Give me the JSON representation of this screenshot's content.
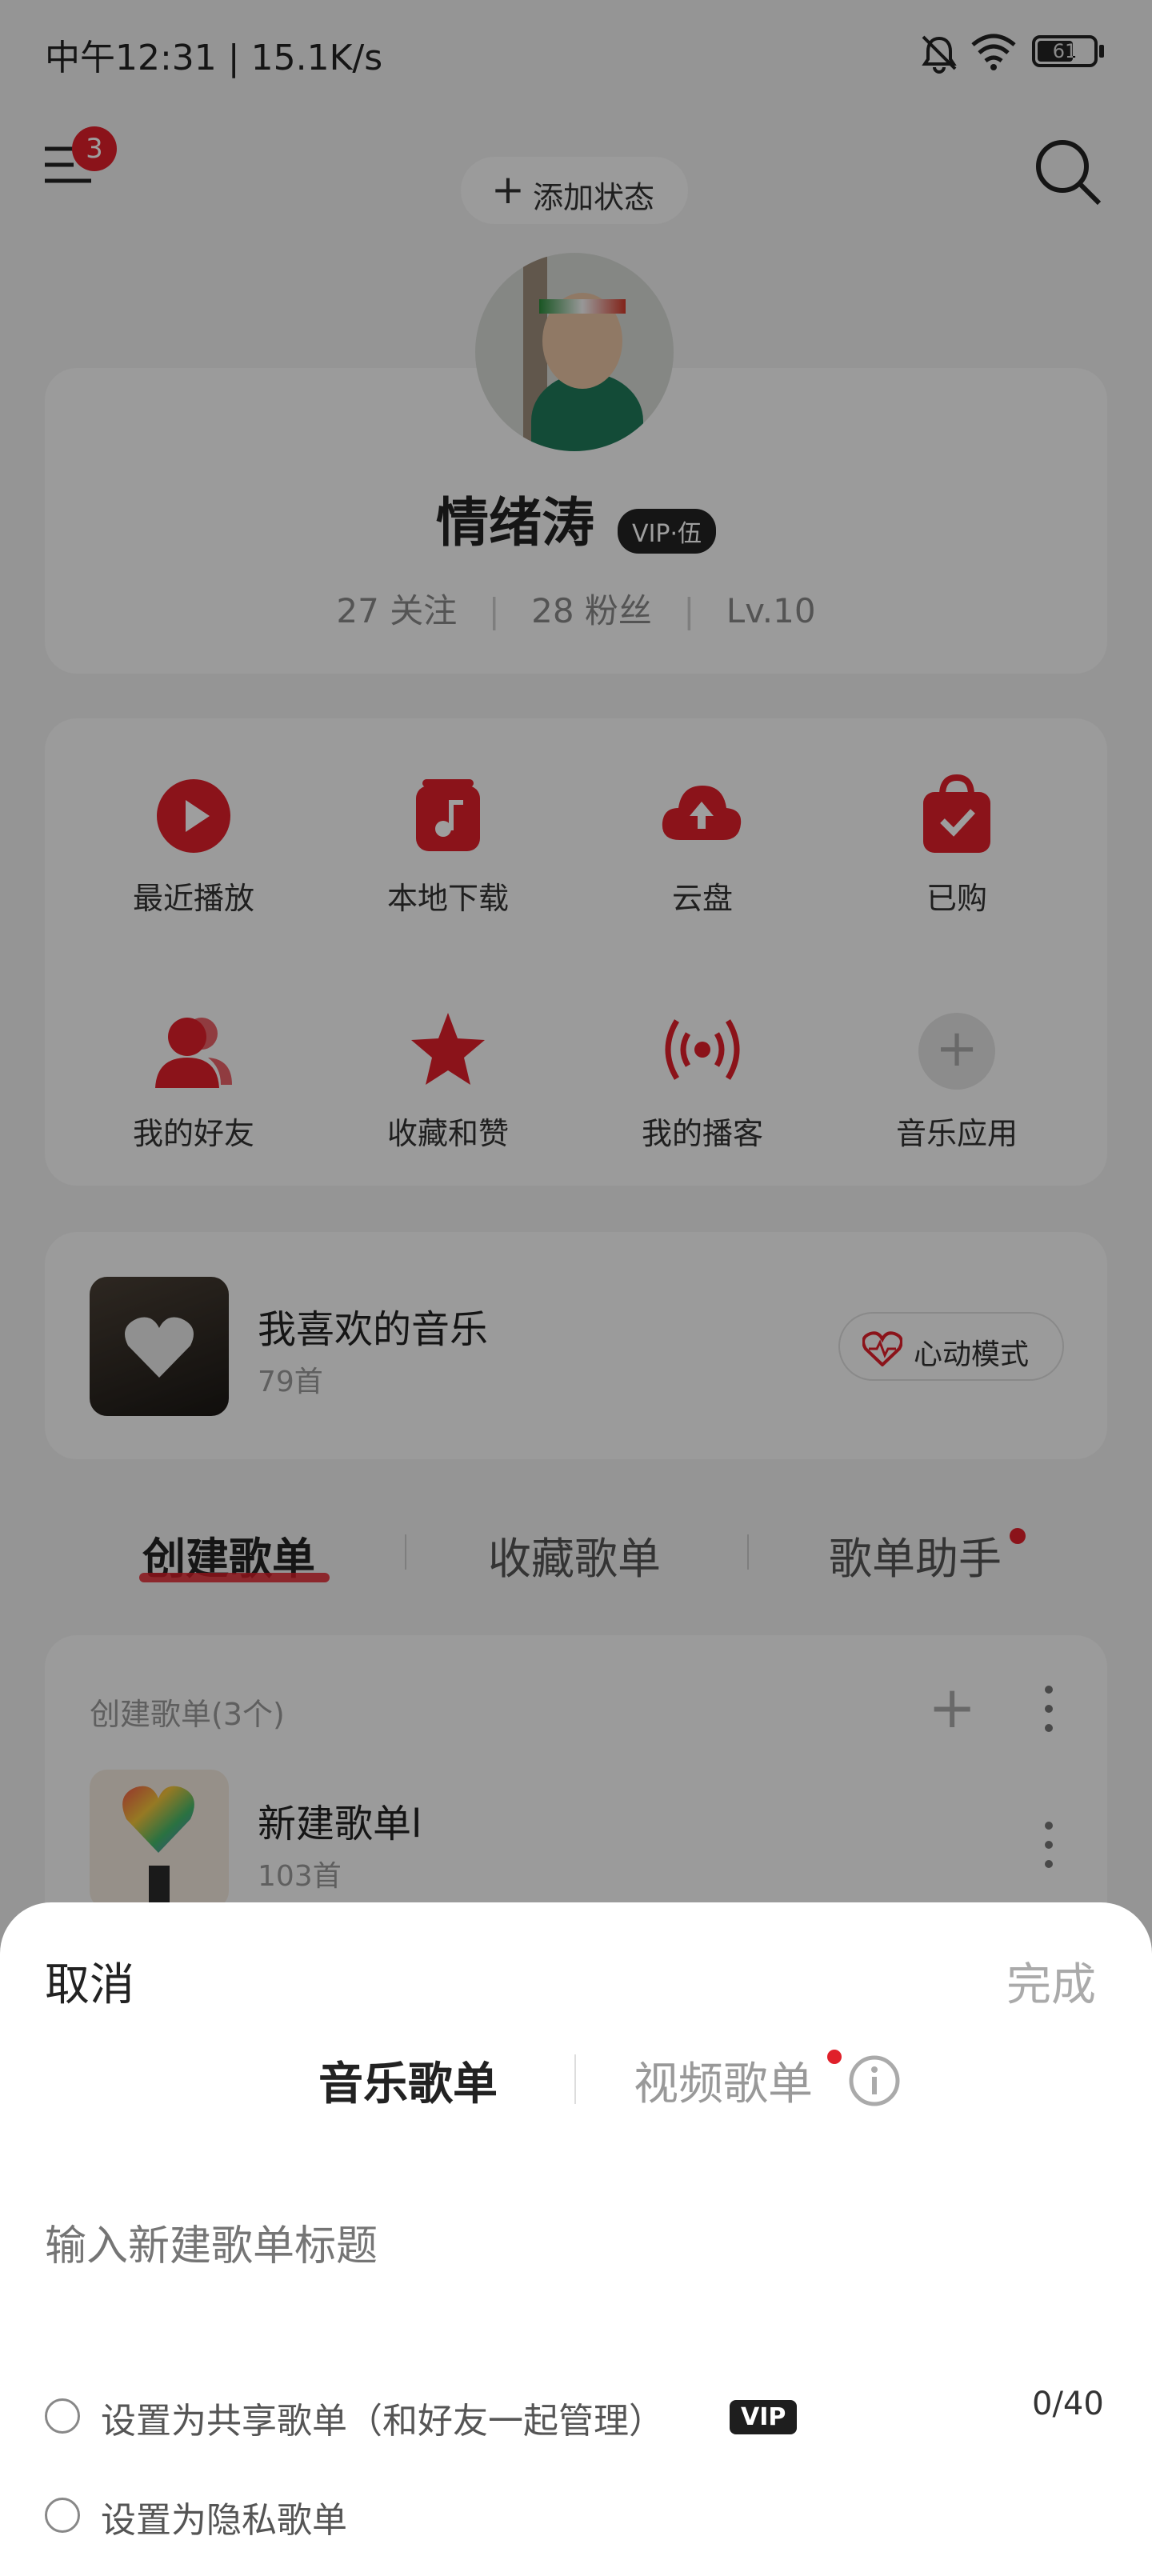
{
  "status_bar": {
    "time": "中午12:31",
    "network": "15.1K/s",
    "battery": "61"
  },
  "header": {
    "menu_badge": "3",
    "add_status": "添加状态"
  },
  "profile": {
    "name": "情绪涛",
    "vip_badge": "VIP·伍",
    "following": "27 关注",
    "fans": "28 粉丝",
    "level": "Lv.10"
  },
  "shortcuts": [
    {
      "label": "最近播放",
      "icon": "play-icon"
    },
    {
      "label": "本地下载",
      "icon": "music-download-icon"
    },
    {
      "label": "云盘",
      "icon": "cloud-upload-icon"
    },
    {
      "label": "已购",
      "icon": "shopping-bag-icon"
    },
    {
      "label": "我的好友",
      "icon": "friends-icon"
    },
    {
      "label": "收藏和赞",
      "icon": "star-icon"
    },
    {
      "label": "我的播客",
      "icon": "podcast-icon"
    },
    {
      "label": "音乐应用",
      "icon": "add-icon"
    }
  ],
  "liked": {
    "title": "我喜欢的音乐",
    "count": "79首",
    "heart_mode": "心动模式"
  },
  "tabs": {
    "created": "创建歌单",
    "collected": "收藏歌单",
    "assistant": "歌单助手"
  },
  "playlist_section": {
    "header": "创建歌单(3个)",
    "items": [
      {
        "title": "新建歌单l",
        "count": "103首"
      }
    ]
  },
  "sheet": {
    "cancel": "取消",
    "done": "完成",
    "tab_music": "音乐歌单",
    "tab_video": "视频歌单",
    "title_placeholder": "输入新建歌单标题",
    "counter": "0/40",
    "option_shared": "设置为共享歌单（和好友一起管理）",
    "option_shared_badge": "VIP",
    "option_private": "设置为隐私歌单"
  },
  "colors": {
    "accent": "#e0202a",
    "overlay": "rgba(0,0,0,0.38)"
  }
}
